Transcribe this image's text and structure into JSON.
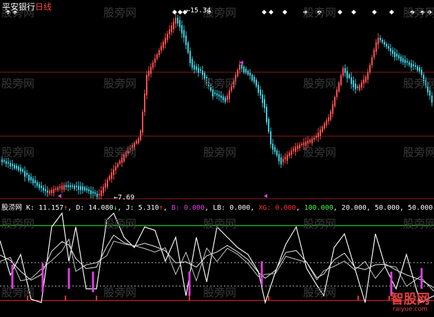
{
  "window": {
    "stock_name": "平安银行",
    "period": "日线"
  },
  "price_panel": {
    "high_label": "15.34",
    "low_label": "7.69",
    "colors": {
      "up": "#ff5050",
      "down": "#40d0e0",
      "gridline": "#8b1a1a",
      "marker": "#ffffff"
    }
  },
  "indicator_bar": {
    "name": "股涝网",
    "K_label": "K:",
    "K_value": "11.157",
    "D_label": "D:",
    "D_value": "14.080",
    "J_label": "J:",
    "J_value": "5.310",
    "B_label": "B:",
    "B_value": "0.000",
    "LB_label": "LB:",
    "LB_value": "0.000",
    "XG_label": "XG:",
    "XG_value": "0.000",
    "level_100": "100.000",
    "level_20": "20.000",
    "level_50": "50.000",
    "level_50b": "50.000",
    "colors": {
      "B": "#e040e0",
      "XG": "#ff3030",
      "level_100": "#40ff40"
    }
  },
  "watermark": "股旁网",
  "logo": {
    "title": "智股网",
    "url": "raiyue.com"
  }
}
